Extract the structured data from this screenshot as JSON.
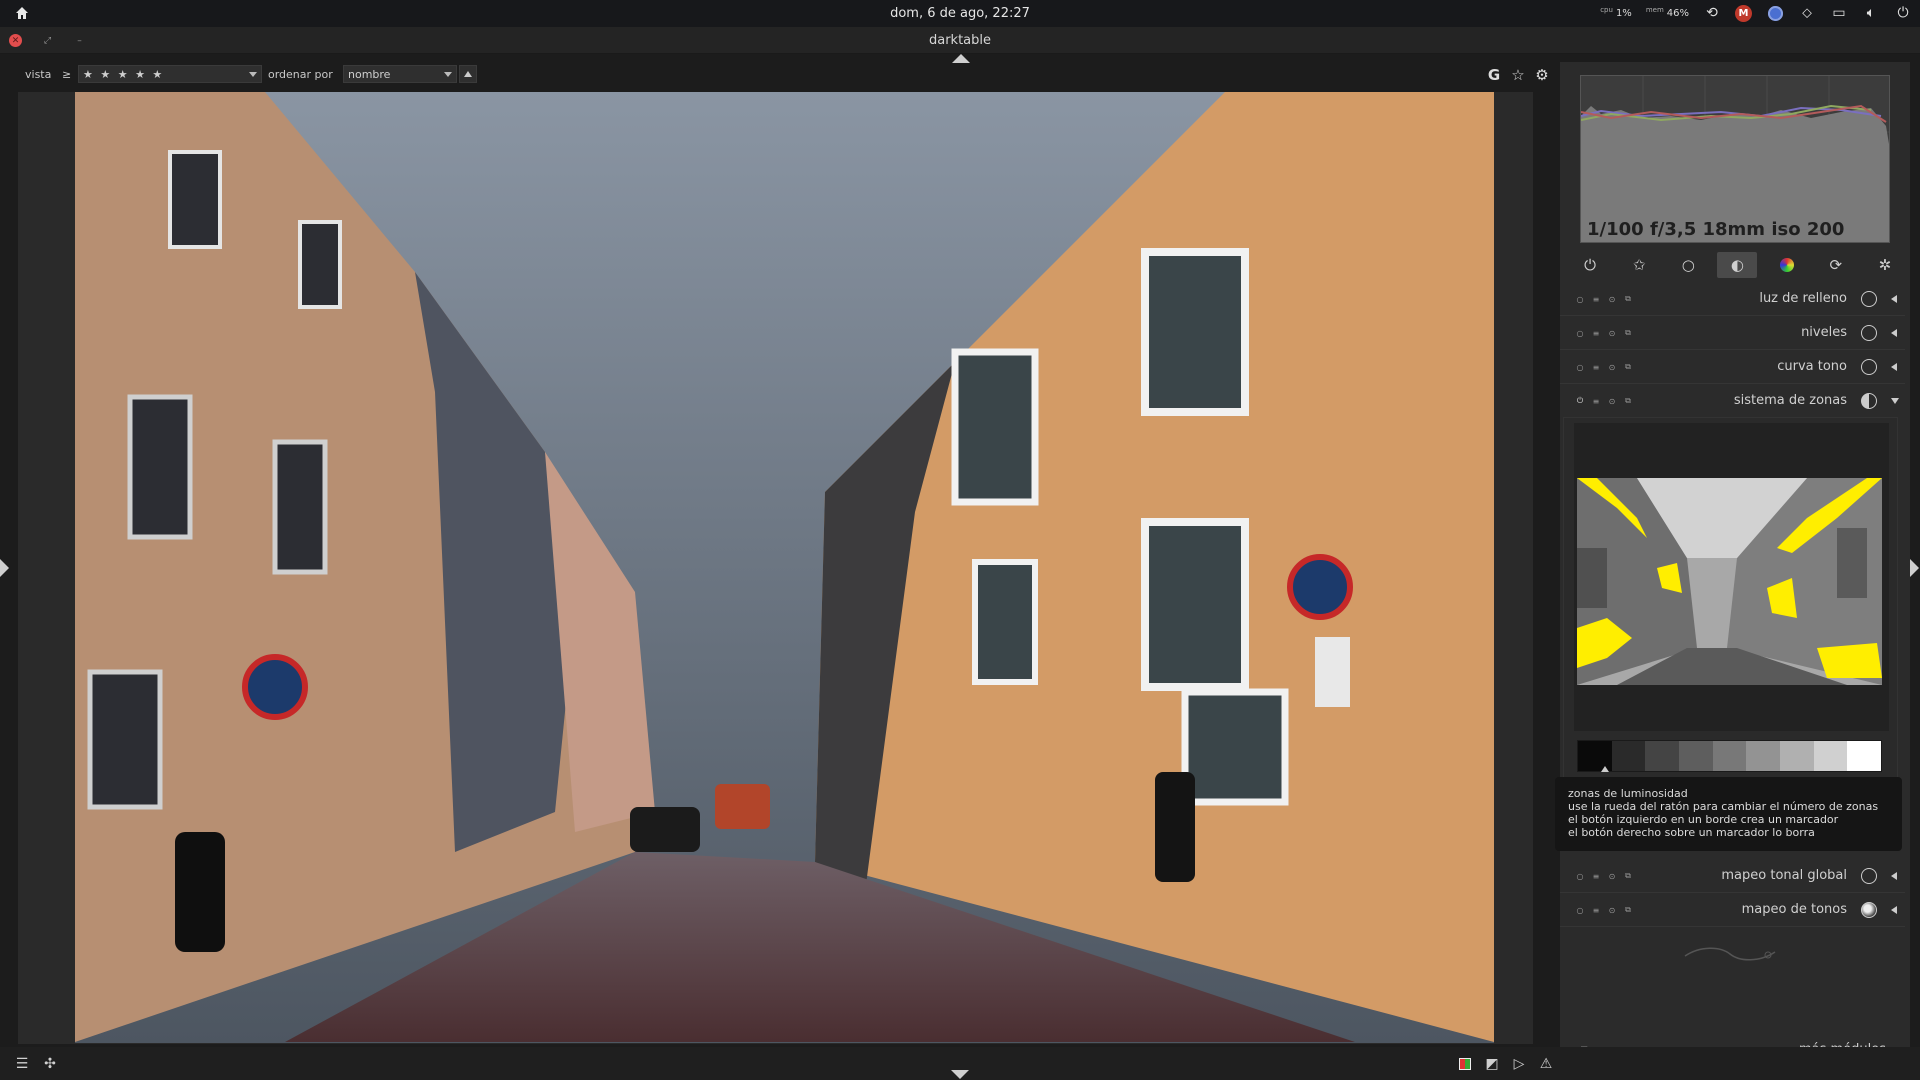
{
  "system": {
    "clock": "dom,  6 de ago, 22:27",
    "cpu_label": "cpu",
    "cpu_value": "1%",
    "mem_label": "mem",
    "mem_value": "46%",
    "mail_badge": "M"
  },
  "window": {
    "title": "darktable"
  },
  "filter": {
    "view_label": "vista",
    "comparator": "≥",
    "rating_value": "★ ★ ★ ★ ★",
    "sort_label": "ordenar por",
    "sort_value": "nombre",
    "toolbar_right": [
      "G",
      "☆",
      "⚙"
    ]
  },
  "histogram": {
    "exif": "1/100 f/3,5 18mm iso 200"
  },
  "module_groups": [
    {
      "name": "power-icon",
      "glyph": "⏻"
    },
    {
      "name": "star-icon",
      "glyph": "✩"
    },
    {
      "name": "circle-icon",
      "glyph": "○"
    },
    {
      "name": "tone-icon",
      "glyph": "◐"
    },
    {
      "name": "color-icon",
      "glyph": "●"
    },
    {
      "name": "correct-icon",
      "glyph": "⟳"
    },
    {
      "name": "effect-icon",
      "glyph": "✲"
    }
  ],
  "modules": {
    "fill_light": "luz de relleno",
    "levels": "niveles",
    "tone_curve": "curva tono",
    "zone_system": "sistema de zonas",
    "global_tonemap": "mapeo tonal global",
    "tonemap": "mapeo de tonos"
  },
  "tooltip": {
    "line1": "zonas de luminosidad",
    "line2": "use la rueda del ratón para cambiar el número de zonas",
    "line3": "el botón izquierdo en un borde crea un marcador",
    "line4": "el botón derecho sobre un marcador lo borra"
  },
  "footer": {
    "more_modules": "más módulos"
  },
  "colors": {
    "accent_zone": "#ffee00",
    "close_button": "#e24d4d",
    "panel_bg": "#2b2b2b"
  },
  "zone_levels": [
    "#0a0a0a",
    "#2a2a2a",
    "#444444",
    "#5e5e5e",
    "#787878",
    "#939393",
    "#b0b0b0",
    "#d0d0d0",
    "#ffffff"
  ]
}
